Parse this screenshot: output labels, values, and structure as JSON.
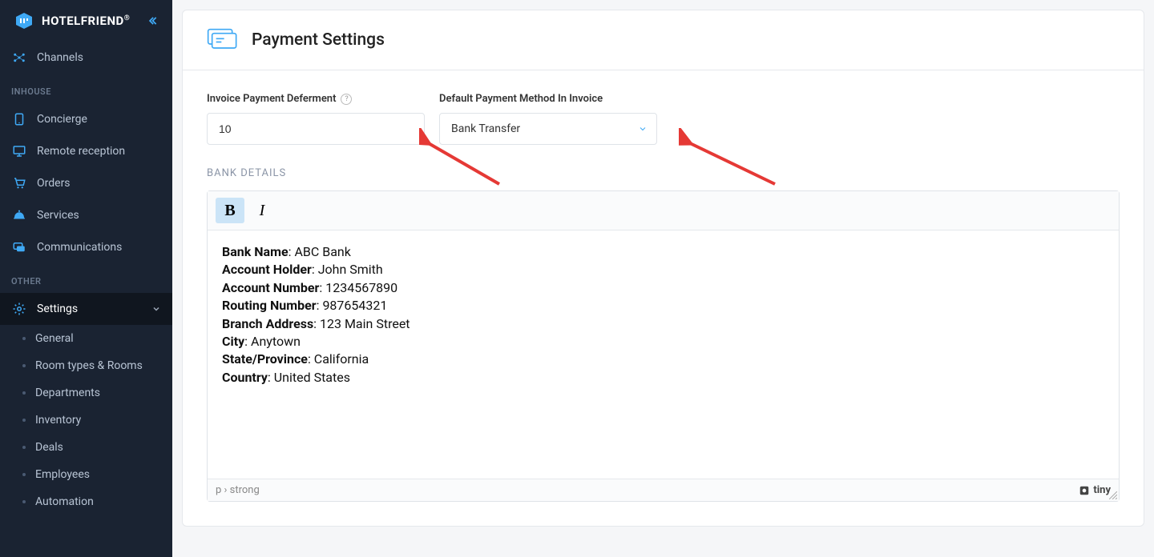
{
  "brand": {
    "name": "HOTELFRIEND",
    "mark": "®"
  },
  "sidebar": {
    "channels": "Channels",
    "section_inhouse": "INHOUSE",
    "concierge": "Concierge",
    "remote_reception": "Remote reception",
    "orders": "Orders",
    "services": "Services",
    "communications": "Communications",
    "section_other": "OTHER",
    "settings": "Settings",
    "sub": {
      "general": "General",
      "room_types": "Room types & Rooms",
      "departments": "Departments",
      "inventory": "Inventory",
      "deals": "Deals",
      "employees": "Employees",
      "automation": "Automation"
    }
  },
  "page": {
    "title": "Payment Settings",
    "deferment_label": "Invoice Payment Deferment",
    "deferment_value": "10",
    "method_label": "Default Payment Method In Invoice",
    "method_value": "Bank Transfer",
    "bank_details_label": "BANK DETAILS"
  },
  "bank": {
    "bank_name_label": "Bank Name",
    "bank_name_value": "ABC Bank",
    "holder_label": "Account Holder",
    "holder_value": "John Smith",
    "acct_label": "Account Number",
    "acct_value": "1234567890",
    "routing_label": "Routing Number",
    "routing_value": "987654321",
    "branch_label": "Branch Address",
    "branch_value": "123 Main Street",
    "city_label": "City",
    "city_value": "Anytown",
    "state_label": "State/Province",
    "state_value": "California",
    "country_label": "Country",
    "country_value": "United States"
  },
  "editor": {
    "path": "p › strong",
    "brand": "tiny"
  }
}
